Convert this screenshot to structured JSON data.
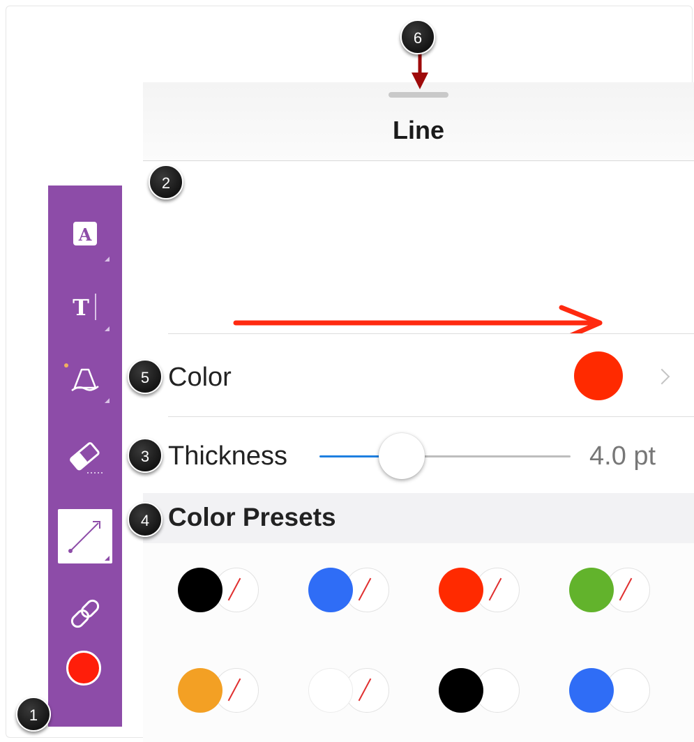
{
  "panel": {
    "title": "Line",
    "preview_line_color": "#ff2a10",
    "color_row": {
      "label": "Color",
      "value_color": "#ff2a00"
    },
    "thickness_row": {
      "label": "Thickness",
      "value": "4.0 pt",
      "slider_fraction": 0.25
    },
    "presets": {
      "title": "Color Presets",
      "items": [
        {
          "color": "#000000",
          "slash": true
        },
        {
          "color": "#2f6df6",
          "slash": true
        },
        {
          "color": "#ff2a00",
          "slash": true
        },
        {
          "color": "#62b32c",
          "slash": true
        },
        {
          "color": "#f3a024",
          "slash": true
        },
        {
          "color": "#ffffff",
          "slash": true
        },
        {
          "color": "#000000",
          "slash": false
        },
        {
          "color": "#2f6df6",
          "slash": false
        }
      ]
    }
  },
  "toolbar": {
    "color": "#8d4ca8",
    "tools": [
      {
        "name": "text-box-tool",
        "icon": "text-box-icon",
        "active": false
      },
      {
        "name": "text-cursor-tool",
        "icon": "text-cursor-icon",
        "active": false
      },
      {
        "name": "pen-tool",
        "icon": "pen-icon",
        "active": false
      },
      {
        "name": "eraser-tool",
        "icon": "eraser-icon",
        "active": false
      },
      {
        "name": "line-tool",
        "icon": "line-arrow-icon",
        "active": true
      },
      {
        "name": "link-tool",
        "icon": "link-icon",
        "active": false
      }
    ],
    "current_color": "#ff1e0a"
  },
  "callouts": [
    "1",
    "2",
    "3",
    "4",
    "5",
    "6"
  ]
}
